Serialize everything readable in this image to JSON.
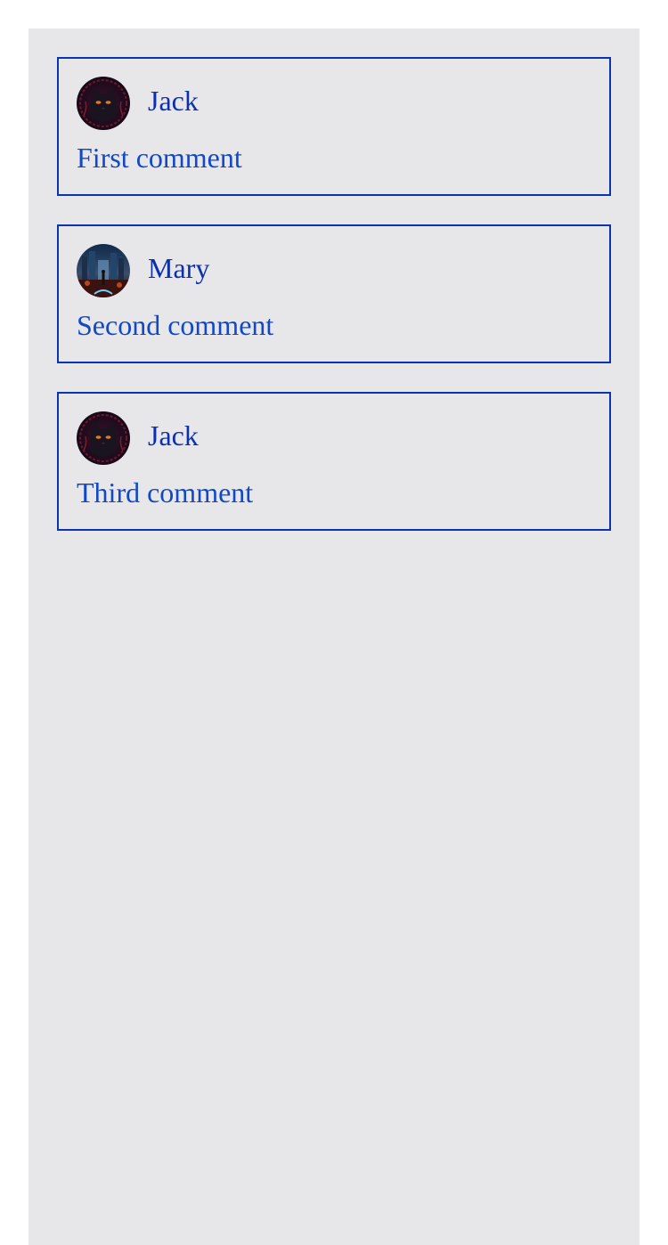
{
  "comments": [
    {
      "author": "Jack",
      "text": "First comment",
      "avatar_icon": "black-cat-avatar-icon"
    },
    {
      "author": "Mary",
      "text": "Second comment",
      "avatar_icon": "city-night-avatar-icon"
    },
    {
      "author": "Jack",
      "text": "Third comment",
      "avatar_icon": "black-cat-avatar-icon"
    }
  ],
  "colors": {
    "panel_background": "#e7e7ea",
    "card_border": "#0b34b3",
    "author_text": "#0b2fae",
    "comment_text": "#1248c8"
  }
}
